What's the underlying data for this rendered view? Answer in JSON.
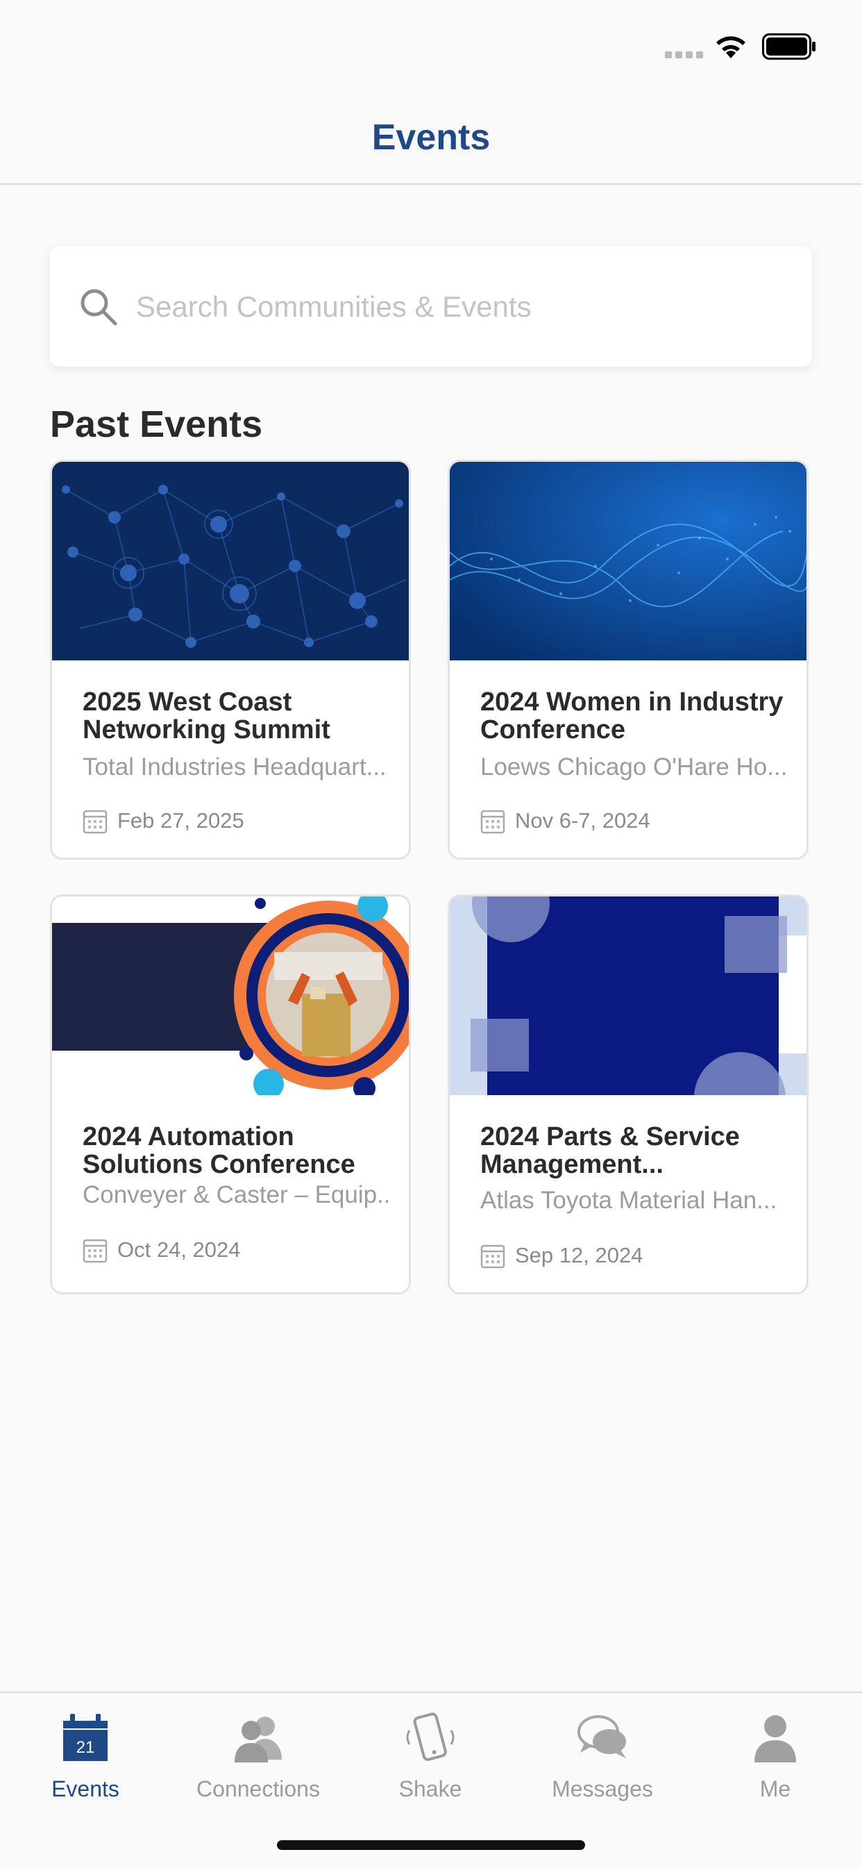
{
  "header": {
    "title": "Events"
  },
  "search": {
    "placeholder": "Search Communities & Events"
  },
  "past_events": {
    "heading": "Past Events",
    "items": [
      {
        "title": "2025 West Coast Networking Summit",
        "location": "Total Industries Headquart...",
        "date": "Feb 27, 2025"
      },
      {
        "title": "2024 Women in Industry Conference",
        "location": "Loews Chicago O'Hare Ho...",
        "date": "Nov 6-7, 2024"
      },
      {
        "title": "2024 Automation Solutions Conference",
        "location": "Conveyer & Caster – Equip...",
        "date": "Oct 24, 2024"
      },
      {
        "title": "2024 Parts & Service Management...",
        "location": "Atlas Toyota Material Han...",
        "date": "Sep 12, 2024"
      }
    ]
  },
  "tab_bar": {
    "tabs": [
      {
        "label": "Events",
        "icon": "calendar-icon",
        "badge": "21",
        "active": true
      },
      {
        "label": "Connections",
        "icon": "people-icon",
        "active": false
      },
      {
        "label": "Shake",
        "icon": "phone-shake-icon",
        "active": false
      },
      {
        "label": "Messages",
        "icon": "chat-bubbles-icon",
        "active": false
      },
      {
        "label": "Me",
        "icon": "person-icon",
        "active": false
      }
    ]
  },
  "colors": {
    "accent": "#1f4a87",
    "inactive": "#9b9b9b",
    "background": "#f9f9fa"
  }
}
